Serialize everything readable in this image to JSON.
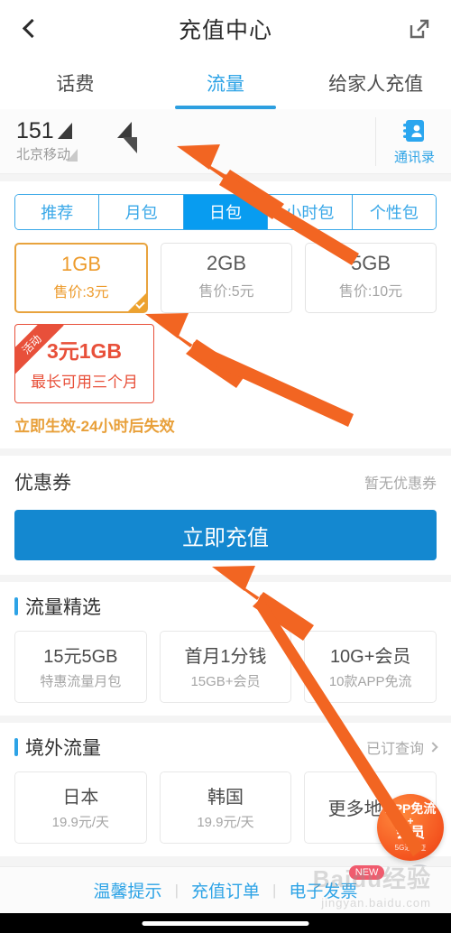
{
  "header": {
    "title": "充值中心",
    "back_icon": "chevron-left-icon",
    "share_icon": "share-external-icon"
  },
  "tabs": [
    {
      "label": "话费",
      "active": false
    },
    {
      "label": "流量",
      "active": true
    },
    {
      "label": "给家人充值",
      "active": false
    }
  ],
  "account": {
    "number": "151",
    "number_masked_note": "",
    "carrier": "北京移动",
    "contacts_label": "通讯录",
    "contacts_icon": "address-book-icon"
  },
  "segmented": [
    {
      "label": "推荐",
      "active": false
    },
    {
      "label": "月包",
      "active": false
    },
    {
      "label": "日包",
      "active": true
    },
    {
      "label": "小时包",
      "active": false
    },
    {
      "label": "个性包",
      "active": false
    }
  ],
  "packages": [
    {
      "title": "1GB",
      "price": "售价:3元",
      "selected": true
    },
    {
      "title": "2GB",
      "price": "售价:5元",
      "selected": false
    },
    {
      "title": "5GB",
      "price": "售价:10元",
      "selected": false
    }
  ],
  "promo": {
    "ribbon": "活动",
    "title": "3元1GB",
    "subtitle": "最长可用三个月",
    "note": "立即生效-24小时后失效"
  },
  "coupon": {
    "title": "优惠券",
    "status": "暂无优惠券"
  },
  "recharge_button": "立即充值",
  "featured": {
    "title": "流量精选",
    "cards": [
      {
        "title": "15元5GB",
        "sub": "特惠流量月包"
      },
      {
        "title": "首月1分钱",
        "sub": "15GB+会员"
      },
      {
        "title": "10G+会员",
        "sub": "10款APP免流"
      }
    ]
  },
  "overseas": {
    "title": "境外流量",
    "more": "已订查询",
    "cards": [
      {
        "title": "日本",
        "sub": "19.9元/天"
      },
      {
        "title": "韩国",
        "sub": "19.9元/天"
      },
      {
        "title": "更多地区",
        "sub": ""
      }
    ]
  },
  "bottom_links": [
    {
      "label": "温馨提示",
      "badge": ""
    },
    {
      "label": "充值订单",
      "badge": ""
    },
    {
      "label": "电子发票",
      "badge": "NEW"
    }
  ],
  "floating_ball": {
    "line1": "APP免流",
    "plus": "+",
    "line2": "会员",
    "line3": "5G通行证"
  },
  "close_icon": "close-circle-icon",
  "watermark": {
    "text": "Baidu经验",
    "url": "jingyan.baidu.com"
  },
  "colors": {
    "accent_blue": "#2da3e6",
    "active_blue": "#089cf0",
    "button_blue": "#1488d0",
    "selected_orange": "#e8a33d",
    "promo_red": "#e8503a",
    "arrow_orange": "#f26522",
    "badge_pink": "#f05b6e"
  }
}
